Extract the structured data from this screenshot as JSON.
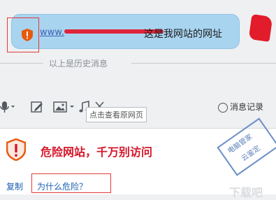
{
  "message": {
    "url_text": "www.",
    "text": "这是我网站的网址"
  },
  "history_label": "以上是历史消息",
  "toolbar": {
    "tooltip": "点击查看原网页",
    "history_button": "消息记录"
  },
  "warning": {
    "title": "危险网站，千万别访问",
    "stamp_line1": "电脑管家",
    "stamp_line2": "云鉴定",
    "copy_link": "复制",
    "why_link": "为什么危险？"
  },
  "colors": {
    "danger": "#d6172a",
    "link": "#1d5fb3",
    "bubble": "#a9d4f0"
  }
}
